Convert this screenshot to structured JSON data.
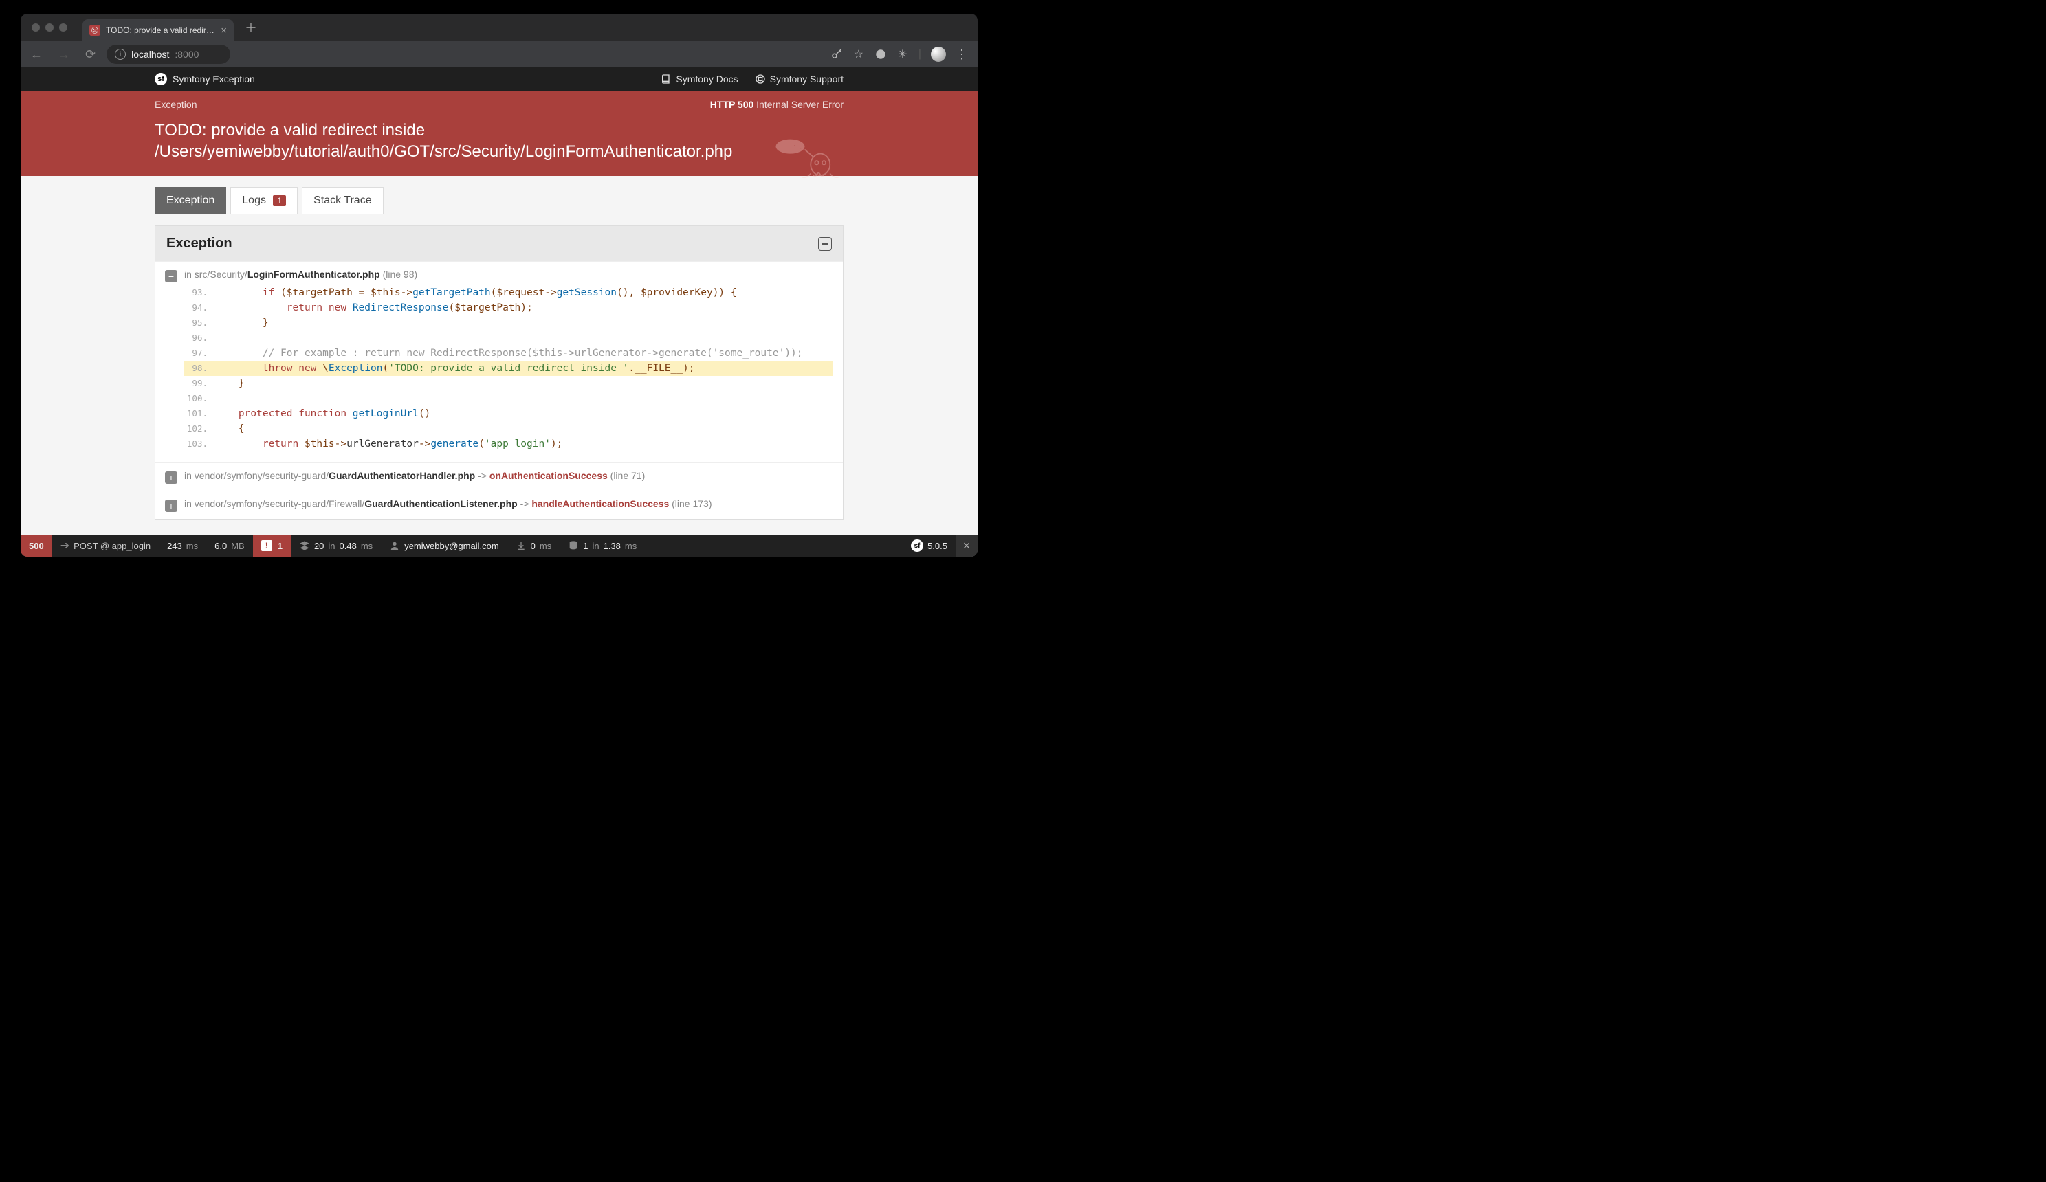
{
  "browser": {
    "tab_title": "TODO: provide a valid redirect",
    "url_host": "localhost",
    "url_port": ":8000"
  },
  "symfony_bar": {
    "title": "Symfony Exception",
    "docs": "Symfony Docs",
    "support": "Symfony Support"
  },
  "error_header": {
    "crumb": "Exception",
    "http_label": "HTTP 500",
    "http_text": "Internal Server Error",
    "title": "TODO: provide a valid redirect inside /Users/yemiwebby/tutorial/auth0/GOT/src/Security/LoginFormAuthenticator.php"
  },
  "tabs": {
    "exception": "Exception",
    "logs": "Logs",
    "logs_count": "1",
    "stack": "Stack Trace"
  },
  "panel": {
    "title": "Exception",
    "trace0_prefix": "in src/Security/",
    "trace0_file": "LoginFormAuthenticator.php",
    "trace0_line": "(line 98)",
    "trace1_prefix": "in vendor/symfony/security-guard/",
    "trace1_file": "GuardAuthenticatorHandler.php",
    "trace1_arrow": " -> ",
    "trace1_method": "onAuthenticationSuccess",
    "trace1_line": "(line 71)",
    "trace2_prefix": "in vendor/symfony/security-guard/Firewall/",
    "trace2_file": "GuardAuthenticationListener.php",
    "trace2_arrow": " -> ",
    "trace2_method": "handleAuthenticationSuccess",
    "trace2_line": "(line 173)"
  },
  "code": {
    "l93n": "93.",
    "l94n": "94.",
    "l95n": "95.",
    "l96n": "96.",
    "l97n": "97.",
    "l98n": "98.",
    "l99n": "99.",
    "l100n": "100.",
    "l101n": "101.",
    "l102n": "102.",
    "l103n": "103."
  },
  "debugbar": {
    "status": "500",
    "post": "POST @ app_login",
    "time": "243",
    "time_unit": "ms",
    "mem": "6.0",
    "mem_unit": "MB",
    "deprec": "1",
    "twig_n": "20",
    "twig_in": "in",
    "twig_ms": "0.48",
    "twig_unit": "ms",
    "user": "yemiwebby@gmail.com",
    "ajax": "0",
    "ajax_unit": "ms",
    "db_n": "1",
    "db_in": "in",
    "db_ms": "1.38",
    "db_unit": "ms",
    "version": "5.0.5"
  }
}
